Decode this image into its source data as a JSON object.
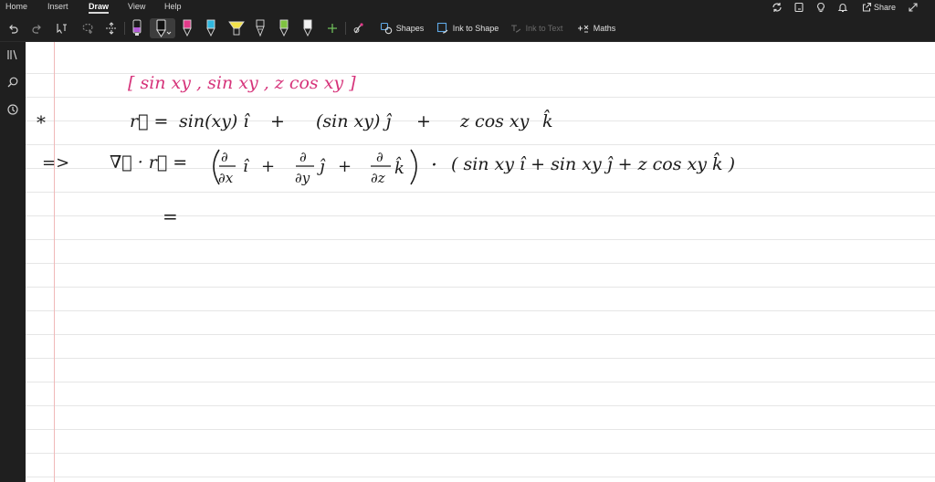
{
  "menu": {
    "items": [
      "Home",
      "Insert",
      "Draw",
      "View",
      "Help"
    ],
    "active": "Draw",
    "share_label": "Share"
  },
  "toolbar": {
    "shapes_label": "Shapes",
    "ink_to_shape_label": "Ink to Shape",
    "ink_to_text_label": "Ink to Text",
    "maths_label": "Maths",
    "pens": [
      {
        "name": "pen-black",
        "color": "#1a1a1a"
      },
      {
        "name": "pen-selected-black",
        "color": "#111111"
      },
      {
        "name": "pen-pink",
        "color": "#e23a8a"
      },
      {
        "name": "pen-cyan",
        "color": "#2fb8e0"
      },
      {
        "name": "highlighter-yellow",
        "color": "#f3e24a"
      },
      {
        "name": "pen-dark",
        "color": "#222222"
      },
      {
        "name": "pen-green",
        "color": "#7fc241"
      },
      {
        "name": "pen-white",
        "color": "#f2f2f2"
      }
    ]
  },
  "ink": {
    "line1": "[ sin xy , sin xy , z cos xy ]",
    "star": "*",
    "line2_lhs": "r⃗ =",
    "line2_t1": "sin(xy) î",
    "line2_plus1": "+",
    "line2_t2": "(sin xy) ĵ",
    "line2_plus2": "+",
    "line2_t3": "z cos xy",
    "line2_k": "k̂",
    "arrow": "=>",
    "line3_lhs": "∇⃗ · r⃗ =",
    "d_num": "∂",
    "dx_den": "∂x",
    "dy_den": "∂y",
    "dz_den": "∂z",
    "i_hat": "î",
    "j_hat": "ĵ",
    "k_hat": "k̂",
    "plus": "+",
    "dot": "·",
    "rhs": "( sin xy  î  + sin xy ĵ + z cos xy k̂ )",
    "eq": "="
  },
  "colors": {
    "pink_ink": "#d6337a",
    "black_ink": "#1b1b1b"
  }
}
